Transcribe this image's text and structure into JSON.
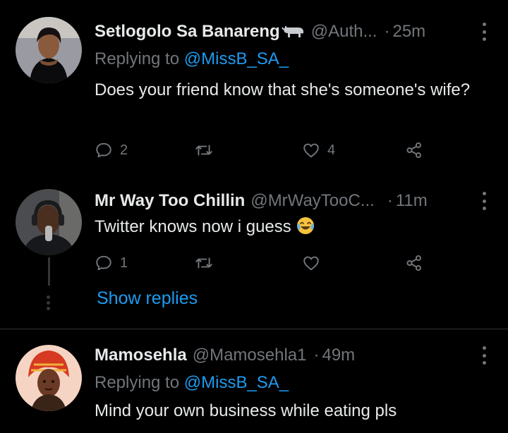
{
  "tweets": [
    {
      "name": "Setlogolo Sa Banareng",
      "handle": "@Auth...",
      "separator": "·",
      "time": "25m",
      "replying_prefix": "Replying to",
      "replying_to": "@MissB_SA_",
      "text": "Does your friend know that she's someone's wife?",
      "counts": {
        "reply": "2",
        "retweet": "",
        "like": "4"
      },
      "name_badge_icon": "cow-icon"
    },
    {
      "name": "Mr Way Too Chillin",
      "handle": "@MrWayTooC...",
      "separator": "·",
      "time": "11m",
      "text": "Twitter knows now i guess",
      "text_emoji_icon": "face-with-tears-of-joy-icon",
      "counts": {
        "reply": "1",
        "retweet": "",
        "like": ""
      }
    },
    {
      "name": "Mamosehla",
      "handle": "@Mamosehla1",
      "separator": "·",
      "time": "49m",
      "replying_prefix": "Replying to",
      "replying_to": "@MissB_SA_",
      "text": "Mind your own business while eating pls"
    }
  ],
  "show_replies": "Show replies",
  "colors": {
    "background": "#000000",
    "primary_text": "#e7e9ea",
    "secondary_text": "#71767b",
    "link": "#1d9bf0",
    "divider": "#2f3336"
  }
}
